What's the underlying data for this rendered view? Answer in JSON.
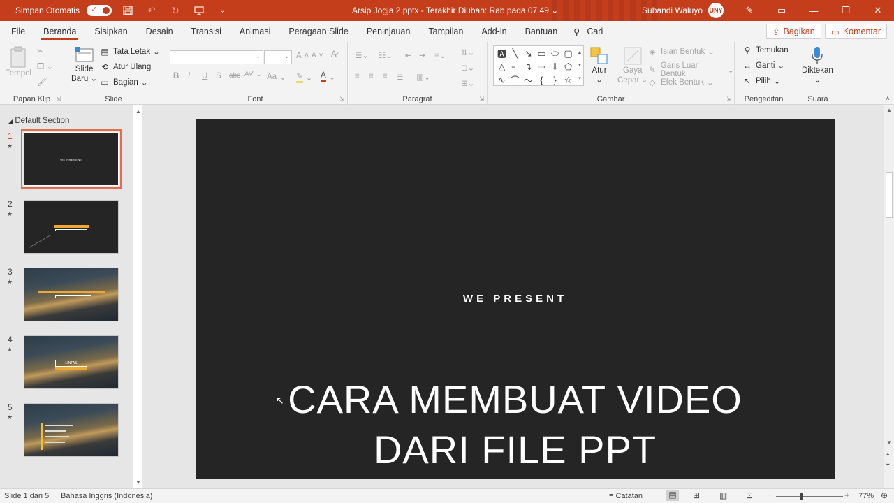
{
  "titlebar": {
    "autosave_label": "Simpan Otomatis",
    "toggle_check": "✓",
    "document_title": "Arsip Jogja 2.pptx  -  Terakhir Diubah: Rab pada 07.49",
    "title_chevron": "⌄",
    "user_name": "Subandi Waluyo",
    "avatar_text": "UNY",
    "minimize": "—",
    "restore": "❐",
    "close": "✕"
  },
  "tabs": [
    "File",
    "Beranda",
    "Sisipkan",
    "Desain",
    "Transisi",
    "Animasi",
    "Peragaan Slide",
    "Peninjauan",
    "Tampilan",
    "Add-in",
    "Bantuan"
  ],
  "search_label": "Cari",
  "share_label": "Bagikan",
  "comment_label": "Komentar",
  "ribbon": {
    "clipboard": {
      "paste": "Tempel",
      "group": "Papan Klip"
    },
    "slide": {
      "new_slide_1": "Slide",
      "new_slide_2": "Baru",
      "layout": "Tata Letak",
      "reset": "Atur Ulang",
      "section": "Bagian",
      "group": "Slide"
    },
    "font": {
      "bold": "B",
      "italic": "I",
      "underline": "U",
      "strike": "S",
      "shadow": "abc",
      "spacing": "AV",
      "case": "Aa",
      "grow": "A",
      "shrink": "A",
      "group": "Font"
    },
    "paragraph": {
      "group": "Paragraf"
    },
    "drawing": {
      "arrange_1": "Atur",
      "quick_styles_1": "Gaya",
      "quick_styles_2": "Cepat",
      "fill": "Isian Bentuk",
      "outline": "Garis Luar Bentuk",
      "effects": "Efek Bentuk",
      "group": "Gambar"
    },
    "editing": {
      "find": "Temukan",
      "replace": "Ganti",
      "select": "Pilih",
      "group": "Pengeditan"
    },
    "voice": {
      "dictate": "Diktekan",
      "group": "Suara"
    }
  },
  "thumbnails": {
    "section_name": "Default Section",
    "slides": [
      {
        "num": "1",
        "text": "WE PRESENT"
      },
      {
        "num": "2",
        "text": ""
      },
      {
        "num": "3",
        "text": ""
      },
      {
        "num": "4",
        "text": "LINTAS"
      },
      {
        "num": "5",
        "text": ""
      }
    ]
  },
  "slide": {
    "subtitle": "WE PRESENT",
    "title_line1": "CARA MEMBUAT VIDEO",
    "title_line2": "DARI FILE PPT"
  },
  "statusbar": {
    "slide_info": "Slide 1 dari 5",
    "language": "Bahasa Inggris (Indonesia)",
    "notes": "Catatan",
    "zoom_minus": "−",
    "zoom_plus": "+",
    "zoom": "77%"
  },
  "colors": {
    "accent": "#c43e1c",
    "slide_bg": "#252525"
  }
}
